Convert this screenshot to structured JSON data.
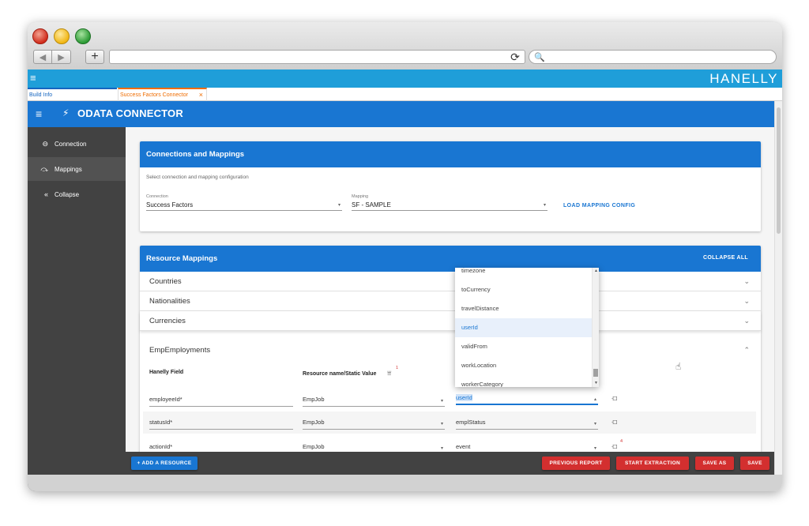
{
  "browser": {
    "back_glyph": "◀",
    "forward_glyph": "▶",
    "new_tab_glyph": "+",
    "reload_glyph": "⟳",
    "search_glyph": "🔍"
  },
  "app": {
    "menu_glyph": "≡",
    "brand": "HANELLY"
  },
  "tabs": [
    {
      "label": "Build Info"
    },
    {
      "label": "Success Factors Connector",
      "close": "×"
    }
  ],
  "header": {
    "menu_glyph": "≡",
    "plug_glyph": "⚡",
    "title": "ODATA CONNECTOR"
  },
  "sidebar": {
    "items": [
      {
        "icon": "⊖",
        "label": "Connection"
      },
      {
        "icon": "⤼",
        "label": "Mappings"
      },
      {
        "icon": "«",
        "label": "Collapse"
      }
    ]
  },
  "connections_card": {
    "title": "Connections and Mappings",
    "subtitle": "Select connection and mapping configuration",
    "connection_label": "Connection",
    "connection_value": "Success Factors",
    "mapping_label": "Mapping",
    "mapping_value": "SF - SAMPLE",
    "load_button": "LOAD MAPPING CONFIG",
    "caret": "▾"
  },
  "resource_card": {
    "title": "Resource Mappings",
    "collapse_all": "COLLAPSE ALL",
    "chevron_down": "⌄",
    "chevron_up": "⌃",
    "panels": [
      {
        "name": "Countries"
      },
      {
        "name": "Nationalities"
      },
      {
        "name": "Currencies"
      }
    ],
    "expanded_panel": "EmpEmployments",
    "col_field": "Hanelly Field",
    "col_resource": "Resource name/Static Value",
    "filter_glyph": "⩸",
    "filter_badge": "1",
    "rows": [
      {
        "field": "employeeId*",
        "resource": "EmpJob",
        "value": "userId",
        "badge": ""
      },
      {
        "field": "statusId*",
        "resource": "EmpJob",
        "value": "emplStatus",
        "badge": ""
      },
      {
        "field": "actionId*",
        "resource": "EmpJob",
        "value": "event",
        "badge": "4"
      }
    ],
    "caret": "▾",
    "caret_up": "▴",
    "crop_glyph": "⟤",
    "hand_glyph": "☝"
  },
  "dropdown": {
    "items": [
      {
        "label": "timezone"
      },
      {
        "label": "toCurrency"
      },
      {
        "label": "travelDistance"
      },
      {
        "label": "userId"
      },
      {
        "label": "validFrom"
      },
      {
        "label": "workLocation"
      },
      {
        "label": "workerCategory"
      }
    ],
    "highlighted": "userId",
    "scroll_up": "▲",
    "scroll_down": "▼"
  },
  "footer": {
    "add_resource": "+ ADD A RESOURCE",
    "previous_report": "PREVIOUS REPORT",
    "start_extraction": "START EXTRACTION",
    "save_as": "SAVE AS",
    "save": "SAVE"
  },
  "colors": {
    "app_bar": "#1f9ed9",
    "primary": "#1976d2",
    "sidebar": "#424242",
    "danger": "#d32f2f",
    "tab_active": "#ef6c00"
  }
}
